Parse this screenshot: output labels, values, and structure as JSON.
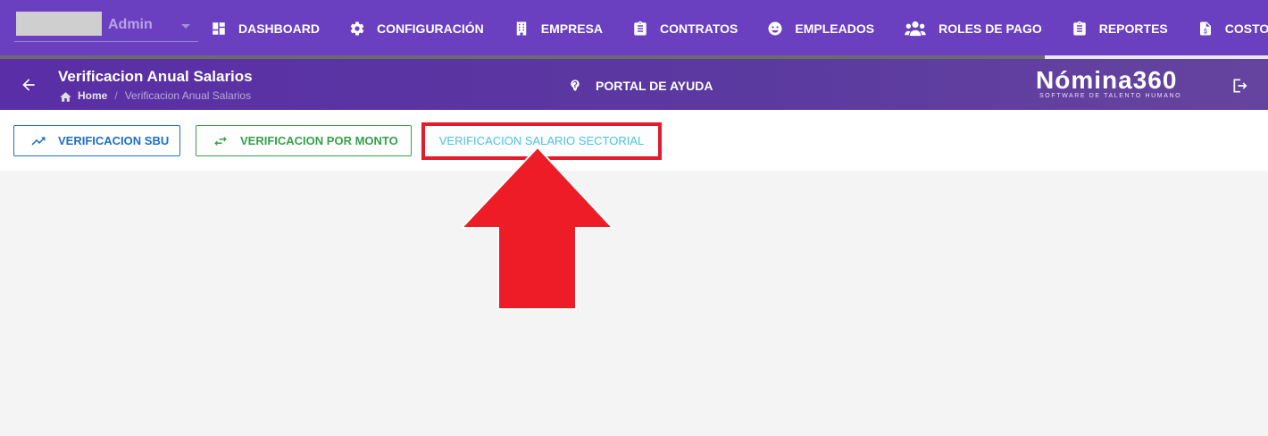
{
  "user": {
    "name": "Admin"
  },
  "nav": {
    "items": [
      {
        "label": "DASHBOARD",
        "icon": "dashboard-icon"
      },
      {
        "label": "CONFIGURACIÓN",
        "icon": "gear-icon"
      },
      {
        "label": "EMPRESA",
        "icon": "building-icon"
      },
      {
        "label": "CONTRATOS",
        "icon": "clipboard-icon"
      },
      {
        "label": "EMPLEADOS",
        "icon": "face-icon"
      },
      {
        "label": "ROLES DE PAGO",
        "icon": "users-icon"
      },
      {
        "label": "REPORTES",
        "icon": "clipboard-icon"
      },
      {
        "label": "COSTOS",
        "icon": "file-dollar-icon"
      }
    ]
  },
  "header": {
    "title": "Verificacion Anual Salarios",
    "breadcrumb": {
      "home": "Home",
      "current": "Verificacion Anual Salarios",
      "separator": "/"
    },
    "help_label": "PORTAL DE AYUDA",
    "brand": {
      "name": "Nómina360",
      "tagline": "SOFTWARE DE TALENTO HUMANO"
    }
  },
  "toolbar": {
    "buttons": [
      {
        "label": "VERIFICACION SBU",
        "icon": "trending-up-icon",
        "color": "#1c6fc2"
      },
      {
        "label": "VERIFICACION POR MONTO",
        "icon": "swap-horizontal-icon",
        "color": "#36a04a"
      },
      {
        "label": "VERIFICACION SALARIO SECTORIAL",
        "color": "#4fc2dc",
        "highlighted": true
      }
    ]
  },
  "colors": {
    "nav_bg": "#6a3fc0",
    "header_bg": "#5a2ea6",
    "highlight": "#e21c2a"
  }
}
